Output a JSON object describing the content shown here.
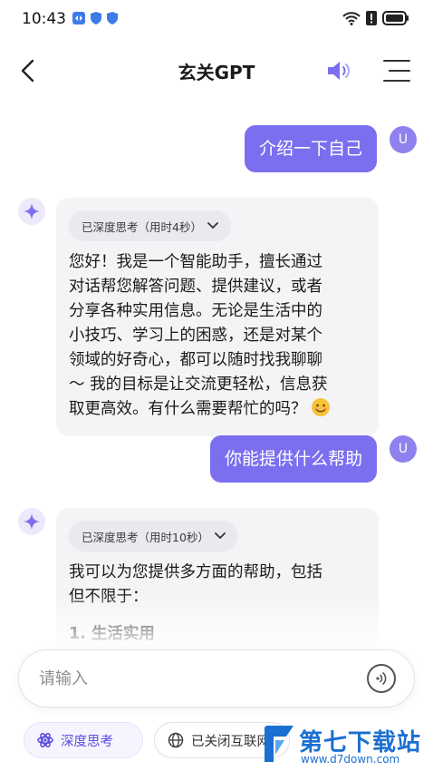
{
  "status_bar": {
    "time": "10:43"
  },
  "header": {
    "title": "玄关GPT"
  },
  "messages": [
    {
      "role": "user",
      "text": "介绍一下自己",
      "avatar": "U"
    },
    {
      "role": "ai",
      "think_label": "已深度思考（用时4秒）",
      "lines": [
        "您好！我是一个智能助手，擅长通过",
        "对话帮您解答问题、提供建议，或者",
        "分享各种实用信息。无论是生活中的",
        "小技巧、学习上的困惑，还是对某个",
        "领域的好奇心，都可以随时找我聊聊",
        "～ 我的目标是让交流更轻松，信息获",
        "取更高效。有什么需要帮忙的吗？"
      ]
    },
    {
      "role": "user",
      "text": "你能提供什么帮助",
      "avatar": "U"
    },
    {
      "role": "ai",
      "think_label": "已深度思考（用时10秒）",
      "lines": [
        "我可以为您提供多方面的帮助，包括",
        "但不限于：",
        "1. 生活实用"
      ]
    }
  ],
  "input": {
    "placeholder": "请输入"
  },
  "chips": {
    "deep_think": "深度思考",
    "web": "已关闭互联网"
  },
  "watermark": {
    "brand": "第七下载站",
    "url": "www.d7down.com"
  },
  "colors": {
    "accent": "#7b6ff0",
    "bubble_ai": "#f4f4f7",
    "watermark": "#1b6fd1"
  }
}
